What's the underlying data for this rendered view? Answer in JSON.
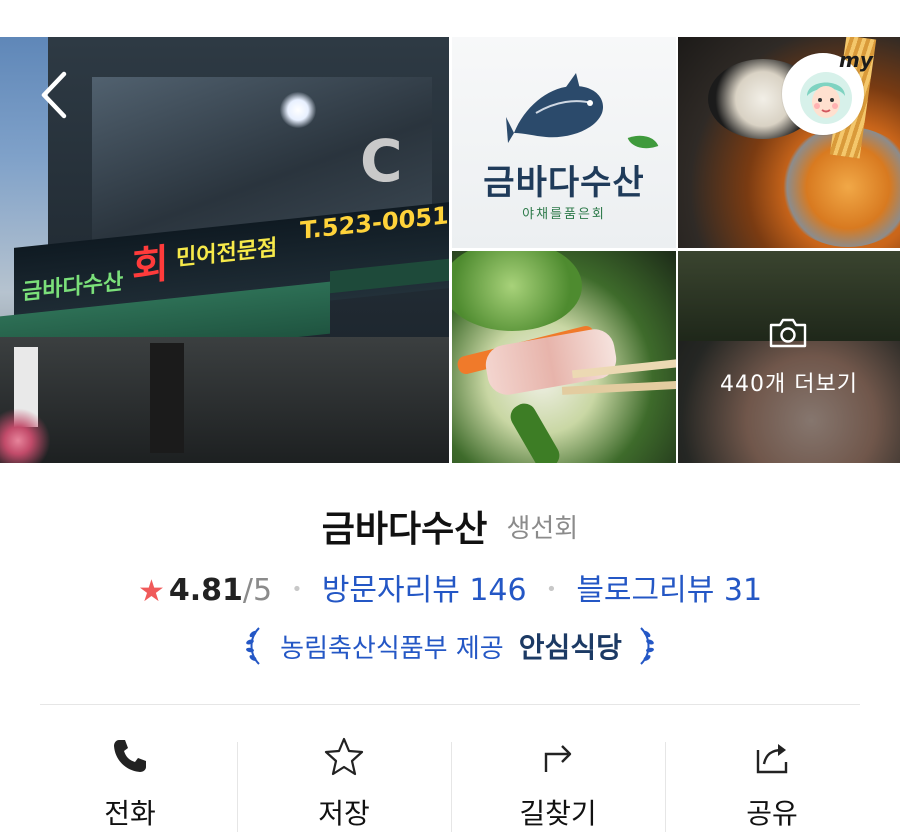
{
  "gallery": {
    "storefront_sign": {
      "brand": "금바다수산",
      "hoe": "회",
      "sub": "민어전문점",
      "tel": "T.523-0051",
      "big": "C"
    },
    "logo": {
      "name": "금바다수산",
      "slogan": "야채를품은회"
    },
    "more_photos_label": "440개 더보기"
  },
  "place": {
    "name": "금바다수산",
    "category": "생선회"
  },
  "rating": {
    "score": "4.81",
    "max": "/5",
    "visitor_review": "방문자리뷰 146",
    "blog_review": "블로그리뷰 31"
  },
  "certification": {
    "provider": "농림축산식품부 제공",
    "badge": "안심식당"
  },
  "avatar": {
    "label": "my"
  },
  "actions": [
    {
      "label": "전화",
      "icon": "phone-icon"
    },
    {
      "label": "저장",
      "icon": "star-icon"
    },
    {
      "label": "길찾기",
      "icon": "directions-icon"
    },
    {
      "label": "공유",
      "icon": "share-icon"
    }
  ],
  "colors": {
    "link": "#2457c5",
    "star": "#f05a5a",
    "badge": "#1c3a64",
    "muted": "#8b8b8b"
  }
}
